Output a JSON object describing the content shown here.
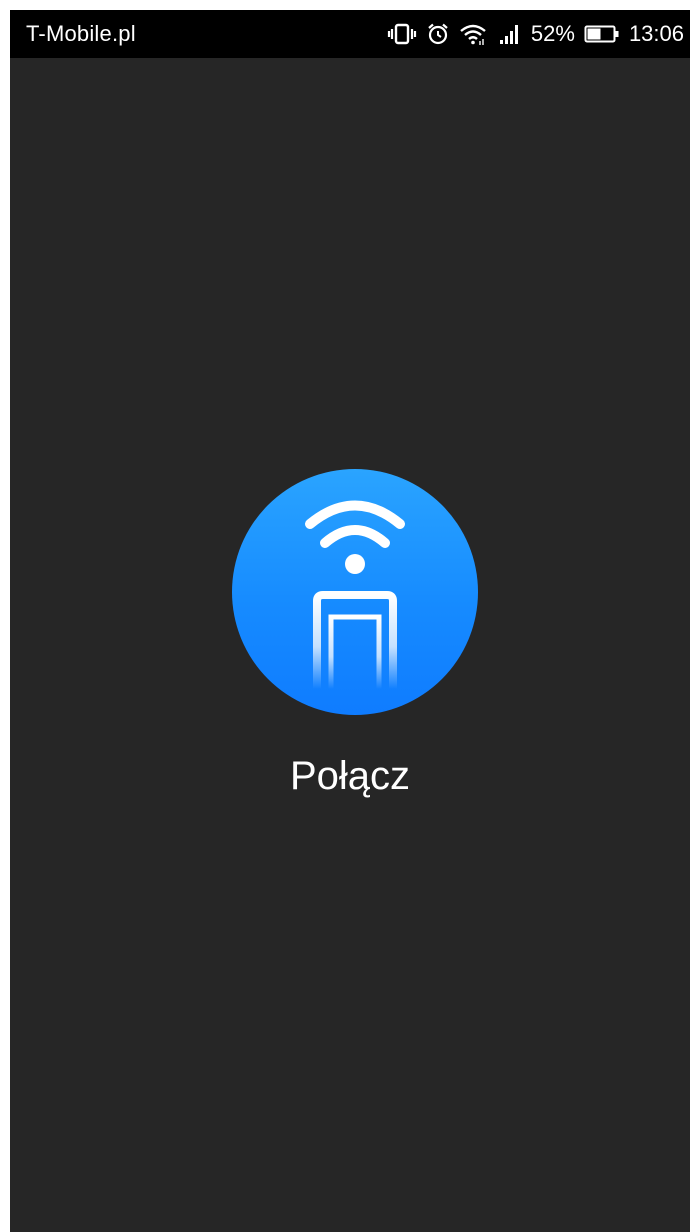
{
  "status_bar": {
    "carrier": "T-Mobile.pl",
    "battery_percent": "52%",
    "battery_level": 0.52,
    "time": "13:06",
    "icons": [
      "vibrate-icon",
      "alarm-icon",
      "wifi-icon",
      "signal-icon",
      "battery-icon"
    ]
  },
  "main": {
    "connect_label": "Połącz",
    "connect_icon": "wifi-door-icon",
    "colors": {
      "background": "#262626",
      "accent": "#168bff",
      "text": "#ffffff"
    }
  }
}
